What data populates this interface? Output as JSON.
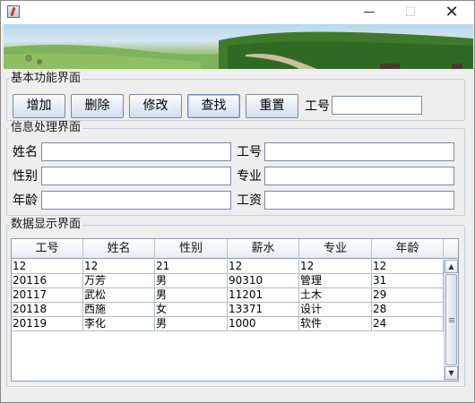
{
  "window": {
    "minimize_glyph": "—",
    "maximize_glyph": "☐",
    "close_glyph": "✕"
  },
  "sections": {
    "basic": "基本功能界面",
    "info": "信息处理界面",
    "data": "数据显示界面"
  },
  "toolbar": {
    "add_label": "增加",
    "delete_label": "删除",
    "modify_label": "修改",
    "find_label": "查找",
    "reset_label": "重置",
    "search_id_label": "工号",
    "search_id_value": ""
  },
  "form": {
    "name_label": "姓名",
    "name_value": "",
    "gender_label": "性别",
    "gender_value": "",
    "age_label": "年龄",
    "age_value": "",
    "id_label": "工号",
    "id_value": "",
    "major_label": "专业",
    "major_value": "",
    "salary_label": "工资",
    "salary_value": ""
  },
  "table": {
    "columns": [
      "工号",
      "姓名",
      "性别",
      "薪水",
      "专业",
      "年龄"
    ],
    "rows": [
      [
        "12",
        "12",
        "21",
        "12",
        "12",
        "12"
      ],
      [
        "20116",
        "万芳",
        "男",
        "90310",
        "管理",
        "31"
      ],
      [
        "20117",
        "武松",
        "男",
        "11201",
        "土木",
        "29"
      ],
      [
        "20118",
        "西施",
        "女",
        "13371",
        "设计",
        "28"
      ],
      [
        "20119",
        "李化",
        "男",
        "1000",
        "软件",
        "24"
      ]
    ]
  },
  "scrollbar": {
    "up_glyph": "▲",
    "down_glyph": "▼"
  },
  "colors": {
    "window_bg": "#eeeeee",
    "border": "#7a8aa2",
    "banner_sky": "#b9d7ee",
    "banner_grass": "#5f9442"
  }
}
